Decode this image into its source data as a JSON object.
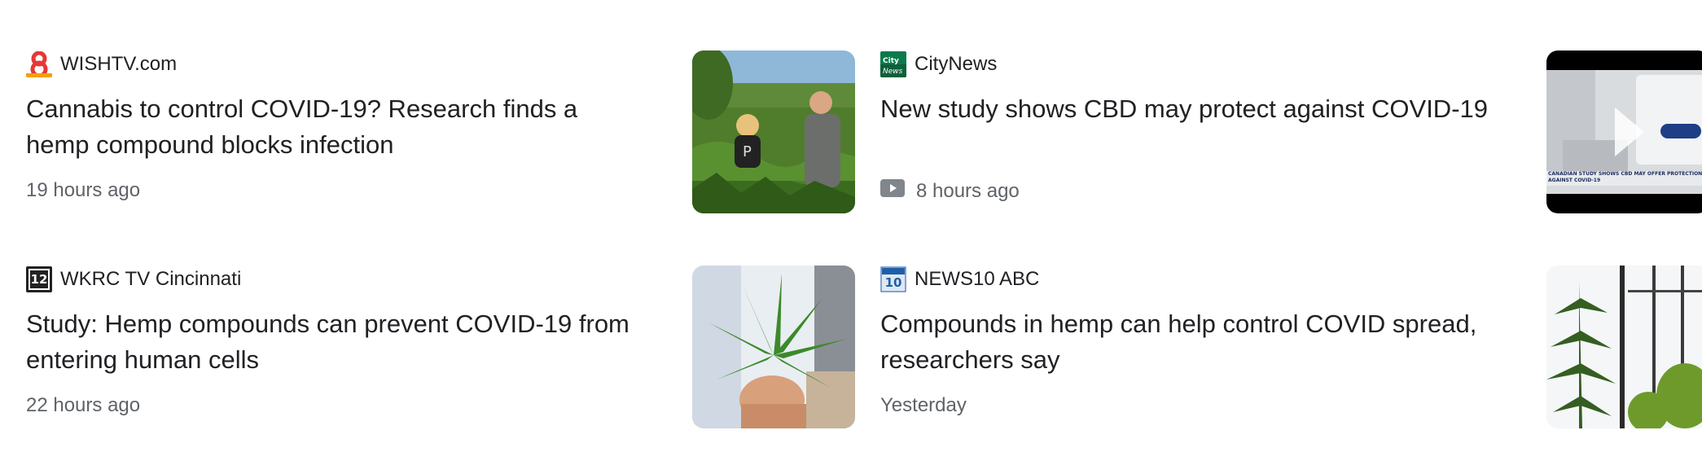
{
  "articles": [
    {
      "source": "WISHTV.com",
      "logo_icon": "wishtv-8-logo-icon",
      "title": "Cannabis to control COVID-19? Research finds a hemp compound blocks infection",
      "time": "19 hours ago",
      "has_video": false,
      "thumbnail_icon": "researchers-in-hemp-field-thumbnail"
    },
    {
      "source": "CityNews",
      "logo_icon": "citynews-logo-icon",
      "title": "New study shows CBD may protect against COVID-19",
      "time": "8 hours ago",
      "has_video": true,
      "thumbnail_icon": "lab-equipment-video-thumbnail",
      "thumbnail_caption": "CANADIAN STUDY SHOWS CBD MAY OFFER PROTECTION AGAINST COVID-19"
    },
    {
      "source": "WKRC TV Cincinnati",
      "logo_icon": "local12-logo-icon",
      "logo_text": "12",
      "title": "Study: Hemp compounds can prevent COVID-19 from entering human cells",
      "time": "22 hours ago",
      "has_video": false,
      "thumbnail_icon": "hand-holding-hemp-leaf-thumbnail"
    },
    {
      "source": "NEWS10 ABC",
      "logo_icon": "news10-abc-logo-icon",
      "logo_text": "10",
      "title": "Compounds in hemp can help control COVID spread, researchers say",
      "time": "Yesterday",
      "has_video": false,
      "thumbnail_icon": "hemp-plants-greenhouse-thumbnail"
    }
  ],
  "colors": {
    "headline": "#202124",
    "meta": "#5f6368",
    "wishtv_red": "#e53935",
    "citynews_green": "#0b7a4b",
    "news10_blue": "#1e5fa8"
  }
}
